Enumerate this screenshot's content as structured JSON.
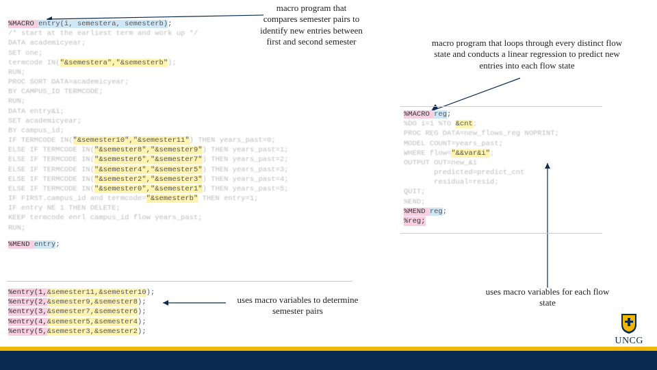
{
  "annotations": {
    "top_left": "macro program that compares semester pairs to identify new entries between first and second semester",
    "top_right": "macro program that loops through every distinct flow state and conducts a linear regression to predict new entries into each flow state",
    "bottom_left": "uses macro variables to determine semester pairs",
    "bottom_right": "uses macro variables for each flow state"
  },
  "logo_text": "UNCG",
  "code_left": {
    "l1_pre": "%MACRO ",
    "l1_hl": "entry(i, semestera, semesterb)",
    "l1_post": ";",
    "l2": "/* start at the earliest term and work up */",
    "l3": "DATA academicyear;",
    "l4": "SET one;",
    "l5a": "termcode IN(",
    "l5b": "\"&semestera\",\"&semesterb\"",
    "l5c": ");",
    "l6": "RUN;",
    "l7": "PROC SORT DATA=academicyear;",
    "l8": "BY CAMPUS_ID TERMCODE;",
    "l9": "RUN;",
    "l10": "DATA entry&i;",
    "l11": "SET academicyear;",
    "l12": "BY campus_id;",
    "l13a": "IF TERMCODE IN(",
    "l13b": "\"&semester10\",\"&semester11\"",
    "l13c": ") THEN years_past=0;",
    "l14a": "ELSE IF TERMCODE IN(",
    "l14b": "\"&semester8\",\"&semester9\"",
    "l14c": ") THEN years_past=1;",
    "l15a": "ELSE IF TERMCODE IN(",
    "l15b": "\"&semester6\",\"&semester7\"",
    "l15c": ") THEN years_past=2;",
    "l16a": "ELSE IF TERMCODE IN(",
    "l16b": "\"&semester4\",\"&semester5\"",
    "l16c": ") THEN years_past=3;",
    "l17a": "ELSE IF TERMCODE IN(",
    "l17b": "\"&semester2\",\"&semester3\"",
    "l17c": ") THEN years_past=4;",
    "l18a": "ELSE IF TERMCODE IN(",
    "l18b": "\"&semester0\",\"&semester1\"",
    "l18c": ") THEN years_past=5;",
    "l19a": "IF FIRST.campus_id and termcode=",
    "l19b": "\"&semesterb\"",
    "l19c": " THEN entry=1;",
    "l20": "IF entry NE 1 THEN DELETE;",
    "l21": "KEEP termcode enrl campus_id flow years_past;",
    "l22": "RUN;",
    "l23a": "%MEND ",
    "l23b": "entry",
    "l23c": ";"
  },
  "code_left2": {
    "l1a": "%entry(1,",
    "l1b": "&semester11,&semester10",
    "l1c": ");",
    "l2a": "%entry(2,",
    "l2b": "&semester9,&semester8",
    "l2c": ");",
    "l3a": "%entry(3,",
    "l3b": "&semester7,&semester6",
    "l3c": ");",
    "l4a": "%entry(4,",
    "l4b": "&semester5,&semester4",
    "l4c": ");",
    "l5a": "%entry(5,",
    "l5b": "&semester3,&semester2",
    "l5c": ");"
  },
  "code_right": {
    "l1a": "%MACRO ",
    "l1b": "reg",
    "l1c": ";",
    "l2a": "%DO i=1 %TO ",
    "l2b": "&cnt",
    "l2c": ";",
    "l3": "PROC REG DATA=new_flows_reg NOPRINT;",
    "l4": "MODEL COUNT=years_past;",
    "l5a": "WHERE flow=",
    "l5b": "\"&&var&i\"",
    "l5c": ";",
    "l6": "OUTPUT OUT=new_&i",
    "l7": "       predicted=predict_cnt",
    "l8": "       residual=resid;",
    "l9": "QUIT;",
    "l10": "%END;",
    "l11a": "%MEND ",
    "l11b": "reg",
    "l11c": ";",
    "l12": "%reg;"
  }
}
